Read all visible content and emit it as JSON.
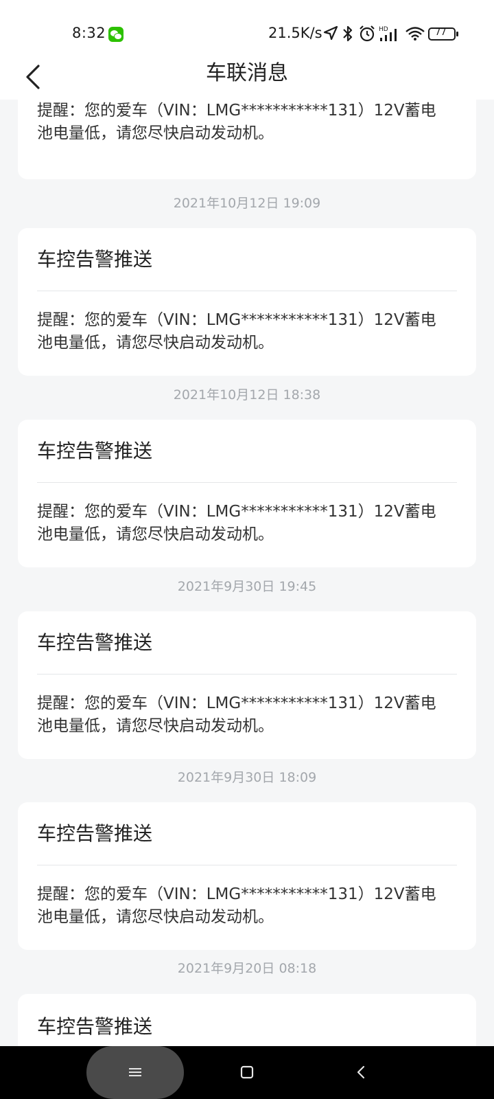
{
  "status_bar": {
    "time": "8:32",
    "speed": "21.5K/s",
    "battery": "77",
    "icons": [
      "wechat-icon",
      "location-icon",
      "bluetooth-icon",
      "alarm-icon",
      "hd-signal-icon",
      "wifi-icon",
      "battery-icon"
    ]
  },
  "header": {
    "title": "车联消息",
    "back_icon": "chevron-left-icon"
  },
  "messages": [
    {
      "title": "",
      "body": "提醒：您的爱车（VIN：LMG***********131）12V蓄电池电量低，请您尽快启动发动机。"
    },
    {
      "timestamp": "2021年10月12日 19:09",
      "title": "车控告警推送",
      "body": "提醒：您的爱车（VIN：LMG***********131）12V蓄电池电量低，请您尽快启动发动机。"
    },
    {
      "timestamp": "2021年10月12日 18:38",
      "title": "车控告警推送",
      "body": "提醒：您的爱车（VIN：LMG***********131）12V蓄电池电量低，请您尽快启动发动机。"
    },
    {
      "timestamp": "2021年9月30日 19:45",
      "title": "车控告警推送",
      "body": "提醒：您的爱车（VIN：LMG***********131）12V蓄电池电量低，请您尽快启动发动机。"
    },
    {
      "timestamp": "2021年9月30日 18:09",
      "title": "车控告警推送",
      "body": "提醒：您的爱车（VIN：LMG***********131）12V蓄电池电量低，请您尽快启动发动机。"
    },
    {
      "timestamp": "2021年9月20日 08:18",
      "title": "车控告警推送",
      "body": ""
    }
  ],
  "nav_bar": {
    "icons": [
      "menu-icon",
      "home-icon",
      "back-icon"
    ]
  }
}
